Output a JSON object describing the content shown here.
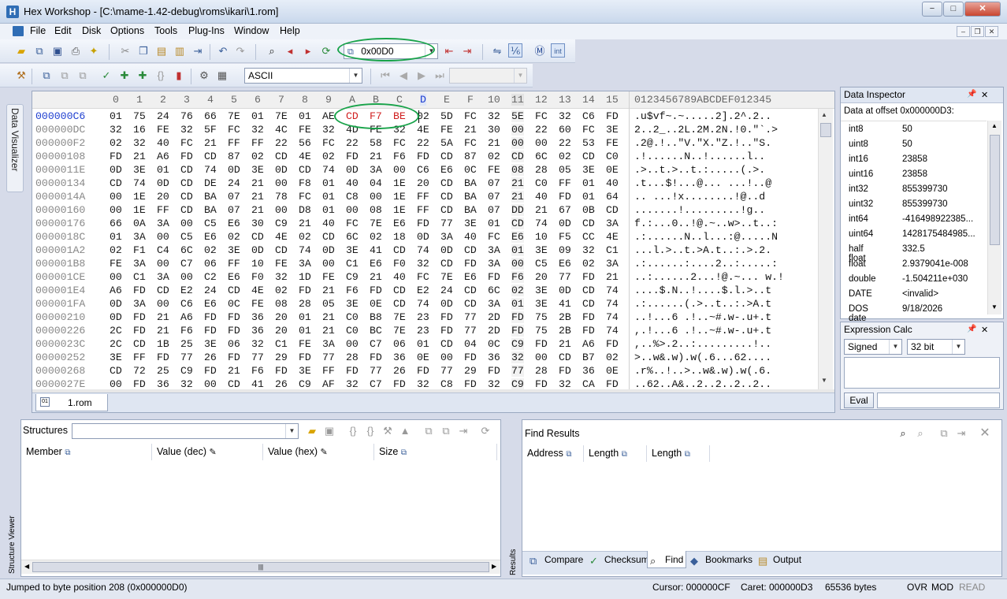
{
  "app": {
    "title": "Hex Workshop - [C:\\mame-1.42-debug\\roms\\ikari\\1.rom]",
    "window_buttons": [
      "−",
      "□",
      "✕"
    ],
    "mdi_buttons": [
      "–",
      "❐",
      "✕"
    ]
  },
  "menu": [
    "File",
    "Edit",
    "Disk",
    "Options",
    "Tools",
    "Plug-Ins",
    "Window",
    "Help"
  ],
  "toolbar": {
    "goto_value": "0x00D0",
    "charset_value": "ASCII",
    "icons_row1": [
      "open-icon",
      "save-all-icon",
      "save-icon",
      "print-icon",
      "properties-icon",
      "cut-icon",
      "copy-icon",
      "paste-icon",
      "paste-special-icon",
      "export-icon",
      "undo-icon",
      "redo-icon",
      "find-icon",
      "find-prev-icon",
      "find-next-icon",
      "replace-icon",
      "goto-icon",
      "bookmark-prev-icon",
      "bookmark-next-icon",
      "compare-icon",
      "byte-order-icon",
      "motorola-icon",
      "intel-icon"
    ],
    "icons_row2": [
      "operation-icon",
      "copy-block-icon",
      "paste-block-icon",
      "fill-icon",
      "checksum-icon",
      "structure-add-icon",
      "data-interpret-icon",
      "histogram-icon",
      "settings-icon",
      "calculator-icon"
    ]
  },
  "sidebar": {
    "visualizer_label": "Data Visualizer"
  },
  "hex": {
    "headers": [
      "0",
      "1",
      "2",
      "3",
      "4",
      "5",
      "6",
      "7",
      "8",
      "9",
      "A",
      "B",
      "C",
      "D",
      "E",
      "F",
      "10",
      "11",
      "12",
      "13",
      "14",
      "15"
    ],
    "ascii_header": "0123456789ABCDEF012345",
    "rows": [
      {
        "off": "000000C6",
        "bytes": [
          "01",
          "75",
          "24",
          "76",
          "66",
          "7E",
          "01",
          "7E",
          "01",
          "AE",
          "CD",
          "F7",
          "BE",
          "02",
          "5D",
          "FC",
          "32",
          "5E",
          "FC",
          "32",
          "C6",
          "FD"
        ],
        "ascii": ".u$vf~.~.....2].2^.2.."
      },
      {
        "off": "000000DC",
        "bytes": [
          "32",
          "16",
          "FE",
          "32",
          "5F",
          "FC",
          "32",
          "4C",
          "FE",
          "32",
          "4D",
          "FE",
          "32",
          "4E",
          "FE",
          "21",
          "30",
          "00",
          "22",
          "60",
          "FC",
          "3E"
        ],
        "ascii": "2..2_..2L.2M.2N.!0.\"`.>"
      },
      {
        "off": "000000F2",
        "bytes": [
          "02",
          "32",
          "40",
          "FC",
          "21",
          "FF",
          "FF",
          "22",
          "56",
          "FC",
          "22",
          "58",
          "FC",
          "22",
          "5A",
          "FC",
          "21",
          "00",
          "00",
          "22",
          "53",
          "FE"
        ],
        "ascii": ".2@.!..\"V.\"X.\"Z.!..\"S."
      },
      {
        "off": "00000108",
        "bytes": [
          "FD",
          "21",
          "A6",
          "FD",
          "CD",
          "87",
          "02",
          "CD",
          "4E",
          "02",
          "FD",
          "21",
          "F6",
          "FD",
          "CD",
          "87",
          "02",
          "CD",
          "6C",
          "02",
          "CD",
          "C0"
        ],
        "ascii": ".!......N..!......l.."
      },
      {
        "off": "0000011E",
        "bytes": [
          "0D",
          "3E",
          "01",
          "CD",
          "74",
          "0D",
          "3E",
          "0D",
          "CD",
          "74",
          "0D",
          "3A",
          "00",
          "C6",
          "E6",
          "0C",
          "FE",
          "08",
          "28",
          "05",
          "3E",
          "0E"
        ],
        "ascii": ".>..t.>..t.:.....(.>."
      },
      {
        "off": "00000134",
        "bytes": [
          "CD",
          "74",
          "0D",
          "CD",
          "DE",
          "24",
          "21",
          "00",
          "F8",
          "01",
          "40",
          "04",
          "1E",
          "20",
          "CD",
          "BA",
          "07",
          "21",
          "C0",
          "FF",
          "01",
          "40"
        ],
        "ascii": ".t...$!...@... ...!..@"
      },
      {
        "off": "0000014A",
        "bytes": [
          "00",
          "1E",
          "20",
          "CD",
          "BA",
          "07",
          "21",
          "78",
          "FC",
          "01",
          "C8",
          "00",
          "1E",
          "FF",
          "CD",
          "BA",
          "07",
          "21",
          "40",
          "FD",
          "01",
          "64"
        ],
        "ascii": ".. ...!x........!@..d"
      },
      {
        "off": "00000160",
        "bytes": [
          "00",
          "1E",
          "FF",
          "CD",
          "BA",
          "07",
          "21",
          "00",
          "D8",
          "01",
          "00",
          "08",
          "1E",
          "FF",
          "CD",
          "BA",
          "07",
          "DD",
          "21",
          "67",
          "0B",
          "CD"
        ],
        "ascii": ".......!.........!g.."
      },
      {
        "off": "00000176",
        "bytes": [
          "66",
          "0A",
          "3A",
          "00",
          "C5",
          "E6",
          "30",
          "C9",
          "21",
          "40",
          "FC",
          "7E",
          "E6",
          "FD",
          "77",
          "3E",
          "01",
          "CD",
          "74",
          "0D",
          "CD",
          "3A"
        ],
        "ascii": "f.:...0..!@.~..w>..t..:"
      },
      {
        "off": "0000018C",
        "bytes": [
          "01",
          "3A",
          "00",
          "C5",
          "E6",
          "02",
          "CD",
          "4E",
          "02",
          "CD",
          "6C",
          "02",
          "18",
          "0D",
          "3A",
          "40",
          "FC",
          "E6",
          "10",
          "F5",
          "CC",
          "4E"
        ],
        "ascii": ".:......N..l...:@.....N"
      },
      {
        "off": "000001A2",
        "bytes": [
          "02",
          "F1",
          "C4",
          "6C",
          "02",
          "3E",
          "0D",
          "CD",
          "74",
          "0D",
          "3E",
          "41",
          "CD",
          "74",
          "0D",
          "CD",
          "3A",
          "01",
          "3E",
          "09",
          "32",
          "C1"
        ],
        "ascii": "...l.>..t.>A.t..:.>.2."
      },
      {
        "off": "000001B8",
        "bytes": [
          "FE",
          "3A",
          "00",
          "C7",
          "06",
          "FF",
          "10",
          "FE",
          "3A",
          "00",
          "C1",
          "E6",
          "F0",
          "32",
          "CD",
          "FD",
          "3A",
          "00",
          "C5",
          "E6",
          "02",
          "3A"
        ],
        "ascii": ".:......:....2..:.....:"
      },
      {
        "off": "000001CE",
        "bytes": [
          "00",
          "C1",
          "3A",
          "00",
          "C2",
          "E6",
          "F0",
          "32",
          "1D",
          "FE",
          "C9",
          "21",
          "40",
          "FC",
          "7E",
          "E6",
          "FD",
          "F6",
          "20",
          "77",
          "FD",
          "21"
        ],
        "ascii": "..:......2...!@.~... w.!"
      },
      {
        "off": "000001E4",
        "bytes": [
          "A6",
          "FD",
          "CD",
          "E2",
          "24",
          "CD",
          "4E",
          "02",
          "FD",
          "21",
          "F6",
          "FD",
          "CD",
          "E2",
          "24",
          "CD",
          "6C",
          "02",
          "3E",
          "0D",
          "CD",
          "74"
        ],
        "ascii": "....$.N..!....$.l.>..t"
      },
      {
        "off": "000001FA",
        "bytes": [
          "0D",
          "3A",
          "00",
          "C6",
          "E6",
          "0C",
          "FE",
          "08",
          "28",
          "05",
          "3E",
          "0E",
          "CD",
          "74",
          "0D",
          "CD",
          "3A",
          "01",
          "3E",
          "41",
          "CD",
          "74"
        ],
        "ascii": ".:......(.>..t..:.>A.t"
      },
      {
        "off": "00000210",
        "bytes": [
          "0D",
          "FD",
          "21",
          "A6",
          "FD",
          "FD",
          "36",
          "20",
          "01",
          "21",
          "C0",
          "B8",
          "7E",
          "23",
          "FD",
          "77",
          "2D",
          "FD",
          "75",
          "2B",
          "FD",
          "74"
        ],
        "ascii": "..!...6 .!..~#.w-.u+.t"
      },
      {
        "off": "00000226",
        "bytes": [
          "2C",
          "FD",
          "21",
          "F6",
          "FD",
          "FD",
          "36",
          "20",
          "01",
          "21",
          "C0",
          "BC",
          "7E",
          "23",
          "FD",
          "77",
          "2D",
          "FD",
          "75",
          "2B",
          "FD",
          "74"
        ],
        "ascii": ",.!...6 .!..~#.w-.u+.t"
      },
      {
        "off": "0000023C",
        "bytes": [
          "2C",
          "CD",
          "1B",
          "25",
          "3E",
          "06",
          "32",
          "C1",
          "FE",
          "3A",
          "00",
          "C7",
          "06",
          "01",
          "CD",
          "04",
          "0C",
          "C9",
          "FD",
          "21",
          "A6",
          "FD"
        ],
        "ascii": ",..%>.2..:.........!.."
      },
      {
        "off": "00000252",
        "bytes": [
          "3E",
          "FF",
          "FD",
          "77",
          "26",
          "FD",
          "77",
          "29",
          "FD",
          "77",
          "28",
          "FD",
          "36",
          "0E",
          "00",
          "FD",
          "36",
          "32",
          "00",
          "CD",
          "B7",
          "02"
        ],
        "ascii": ">..w&.w).w(.6...62...."
      },
      {
        "off": "00000268",
        "bytes": [
          "CD",
          "72",
          "25",
          "C9",
          "FD",
          "21",
          "F6",
          "FD",
          "3E",
          "FF",
          "FD",
          "77",
          "26",
          "FD",
          "77",
          "29",
          "FD",
          "77",
          "28",
          "FD",
          "36",
          "0E"
        ],
        "ascii": ".r%..!..>..w&.w).w(.6."
      },
      {
        "off": "0000027E",
        "bytes": [
          "00",
          "FD",
          "36",
          "32",
          "00",
          "CD",
          "41",
          "26",
          "C9",
          "AF",
          "32",
          "C7",
          "FD",
          "32",
          "C8",
          "FD",
          "32",
          "C9",
          "FD",
          "32",
          "CA",
          "FD"
        ],
        "ascii": "..62..A&..2..2..2..2.."
      }
    ]
  },
  "doc_tab": "1.rom",
  "inspector": {
    "title": "Data Inspector",
    "offset_label": "Data at offset 0x000000D3:",
    "rows": [
      {
        "name": "int8",
        "value": "50"
      },
      {
        "name": "uint8",
        "value": "50"
      },
      {
        "name": "int16",
        "value": "23858"
      },
      {
        "name": "uint16",
        "value": "23858"
      },
      {
        "name": "int32",
        "value": "855399730"
      },
      {
        "name": "uint32",
        "value": "855399730"
      },
      {
        "name": "int64",
        "value": "-416498922385..."
      },
      {
        "name": "uint64",
        "value": "1428175484985..."
      },
      {
        "name": "half float",
        "value": "332.5"
      },
      {
        "name": "float",
        "value": "2.9379041e-008"
      },
      {
        "name": "double",
        "value": "-1.504211e+030"
      },
      {
        "name": "DATE",
        "value": "<invalid>"
      },
      {
        "name": "DOS date",
        "value": "9/18/2026"
      }
    ]
  },
  "exprcalc": {
    "title": "Expression Calc",
    "sign": "Signed",
    "bits": "32 bit",
    "eval": "Eval"
  },
  "structures": {
    "label": "Structures",
    "side_label": "Structure Viewer",
    "columns": [
      "Member",
      "Value (dec)",
      "Value (hex)",
      "Size"
    ]
  },
  "find": {
    "title": "Find Results",
    "side_label": "Results",
    "columns": [
      "Address",
      "Length",
      "Length"
    ],
    "tabs": [
      "Compare",
      "Checksum",
      "Find",
      "Bookmarks",
      "Output"
    ]
  },
  "status": {
    "message": "Jumped to byte position 208 (0x000000D0)",
    "cursor": "Cursor: 000000CF",
    "caret": "Caret: 000000D3",
    "size": "65536 bytes",
    "ovr": "OVR",
    "mod": "MOD",
    "read": "READ"
  },
  "colors": {
    "accent": "#2f6db5",
    "highlight_ellipse": "#19a34a",
    "selected_bytes": "#d01f1f",
    "offset_active": "#1f3fd0"
  }
}
